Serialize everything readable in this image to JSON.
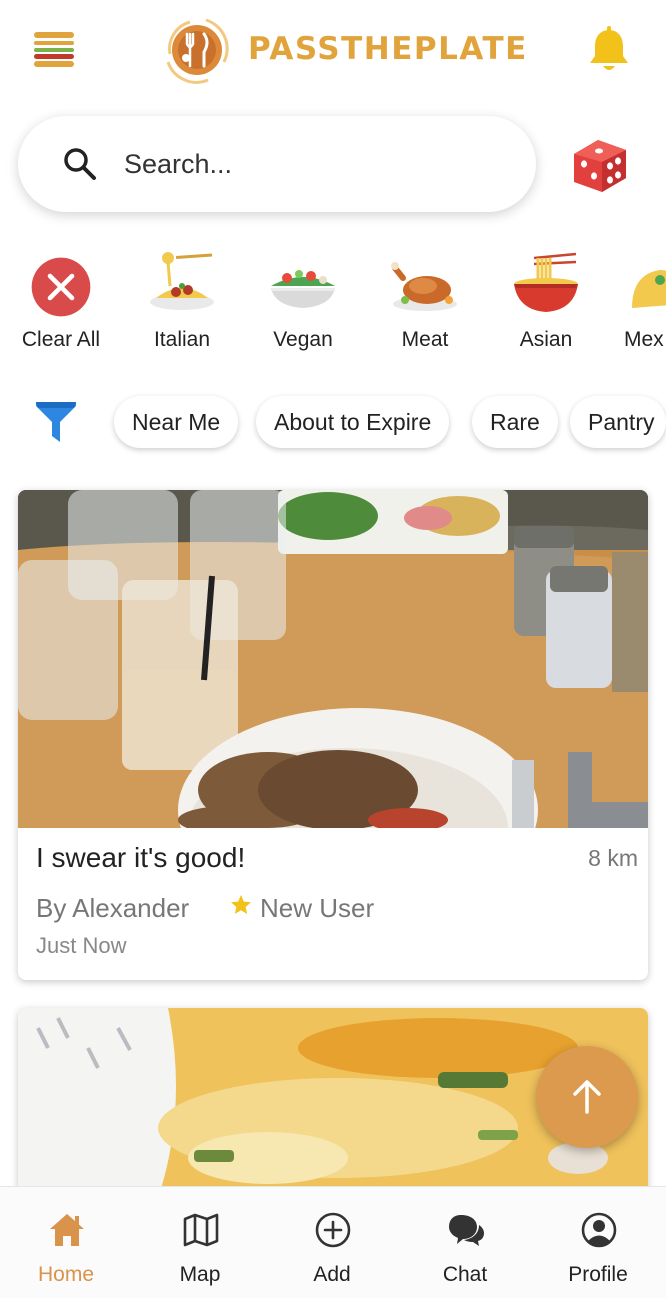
{
  "app": {
    "brand": "PASSTHEPLATE",
    "brand_color": "#E1A43C",
    "accent_color": "#D9934A"
  },
  "header": {
    "menu_icon": "hamburger-menu-icon",
    "notification_icon": "bell-icon"
  },
  "search": {
    "placeholder": "Search...",
    "value": "",
    "random_button_icon": "dice-icon"
  },
  "categories": [
    {
      "label": "Clear All",
      "icon": "close-circle-icon"
    },
    {
      "label": "Italian",
      "icon": "pasta-icon"
    },
    {
      "label": "Vegan",
      "icon": "salad-bowl-icon"
    },
    {
      "label": "Meat",
      "icon": "roast-chicken-icon"
    },
    {
      "label": "Asian",
      "icon": "noodle-bowl-icon"
    },
    {
      "label": "Mex",
      "icon": "taco-icon"
    }
  ],
  "filters": {
    "icon": "filter-funnel-icon",
    "chips": [
      "Near Me",
      "About to Expire",
      "Rare",
      "Pantry"
    ]
  },
  "posts": [
    {
      "title": "I swear it's good!",
      "distance": "8 km",
      "author": "By Alexander",
      "badge": "New User",
      "time": "Just Now"
    }
  ],
  "bottom_nav": [
    {
      "label": "Home",
      "icon": "home-icon",
      "active": true
    },
    {
      "label": "Map",
      "icon": "map-icon",
      "active": false
    },
    {
      "label": "Add",
      "icon": "plus-circle-icon",
      "active": false
    },
    {
      "label": "Chat",
      "icon": "chat-bubbles-icon",
      "active": false
    },
    {
      "label": "Profile",
      "icon": "user-circle-icon",
      "active": false
    }
  ]
}
